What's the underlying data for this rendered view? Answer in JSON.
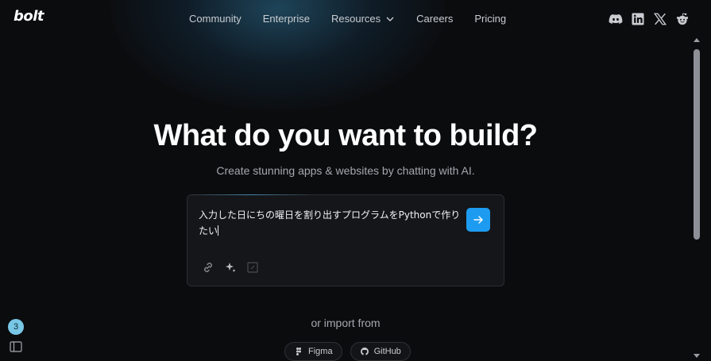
{
  "header": {
    "logo": "bolt",
    "nav": [
      {
        "label": "Community"
      },
      {
        "label": "Enterprise"
      },
      {
        "label": "Resources"
      },
      {
        "label": "Careers"
      },
      {
        "label": "Pricing"
      }
    ],
    "socials": [
      "discord-icon",
      "linkedin-icon",
      "x-icon",
      "reddit-icon"
    ]
  },
  "hero": {
    "title": "What do you want to build?",
    "subtitle": "Create stunning apps & websites by chatting with AI."
  },
  "prompt": {
    "value": "入力した日にちの曜日を割り出すプログラムをPythonで作りたい"
  },
  "import": {
    "label": "or import from",
    "options": [
      {
        "label": "Figma"
      },
      {
        "label": "GitHub"
      }
    ]
  },
  "notifications": {
    "count": "3"
  },
  "colors": {
    "accent": "#1d9bf0",
    "background": "#0b0c0e",
    "badge": "#79c7e6"
  }
}
